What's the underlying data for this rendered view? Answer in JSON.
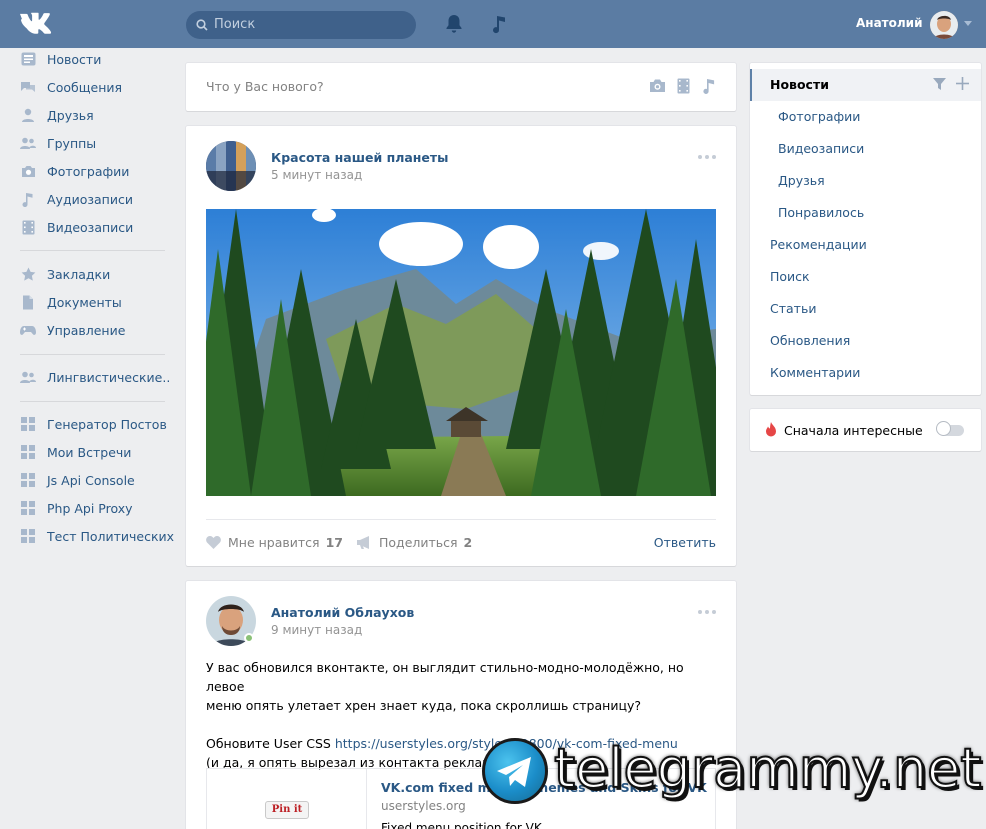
{
  "header": {
    "search_placeholder": "Поиск",
    "user_name": "Анатолий"
  },
  "leftnav": {
    "items": [
      {
        "label": "Новости",
        "icon": "news-icon"
      },
      {
        "label": "Сообщения",
        "icon": "messages-icon"
      },
      {
        "label": "Друзья",
        "icon": "friends-icon"
      },
      {
        "label": "Группы",
        "icon": "groups-icon"
      },
      {
        "label": "Фотографии",
        "icon": "camera-icon"
      },
      {
        "label": "Аудиозаписи",
        "icon": "music-icon"
      },
      {
        "label": "Видеозаписи",
        "icon": "film-icon"
      },
      {
        "label": "Закладки",
        "icon": "star-icon"
      },
      {
        "label": "Документы",
        "icon": "document-icon"
      },
      {
        "label": "Управление",
        "icon": "gamepad-icon"
      },
      {
        "label": "Лингвистические..",
        "icon": "community-icon"
      },
      {
        "label": "Генератор Постов",
        "icon": "app-icon"
      },
      {
        "label": "Мои Встречи",
        "icon": "app-icon"
      },
      {
        "label": "Js Api Console",
        "icon": "app-icon"
      },
      {
        "label": "Php Api Proxy",
        "icon": "app-icon"
      },
      {
        "label": "Тест Политических",
        "icon": "app-icon"
      }
    ]
  },
  "composer": {
    "placeholder": "Что у Вас нового?"
  },
  "post1": {
    "author": "Красота нашей планеты",
    "time": "5 минут назад",
    "like_label": "Мне нравится",
    "like_count": "17",
    "share_label": "Поделиться",
    "share_count": "2",
    "reply_label": "Ответить"
  },
  "post2": {
    "author": "Анатолий Облаухов",
    "time": "9 минут назад",
    "text_line1": "У вас обновился вконтакте, он выглядит стильно-модно-молодёжно, но левое",
    "text_line2": "меню опять улетает хрен знает куда, пока скроллишь страницу?",
    "text_line3_prefix": "Обновите User CSS ",
    "text_link": "https://userstyles.org/styles/92800/vk-com-fixed-menu",
    "text_line4": "(и да, я опять вырезал из контакта рекламу, на...й)",
    "attach_pin": "Pin it",
    "attach_title": "VK.com fixed menu - Themes and Skins for VK",
    "attach_site": "userstyles.org",
    "attach_desc": "Fixed menu position for VK"
  },
  "rightmenu": {
    "items": [
      {
        "label": "Новости",
        "level": "main",
        "active": true
      },
      {
        "label": "Фотографии",
        "level": "sub"
      },
      {
        "label": "Видеозаписи",
        "level": "sub"
      },
      {
        "label": "Друзья",
        "level": "sub"
      },
      {
        "label": "Понравилось",
        "level": "sub"
      },
      {
        "label": "Рекомендации",
        "level": "main"
      },
      {
        "label": "Поиск",
        "level": "main"
      },
      {
        "label": "Статьи",
        "level": "main"
      },
      {
        "label": "Обновления",
        "level": "main"
      },
      {
        "label": "Комментарии",
        "level": "main"
      }
    ]
  },
  "toggle": {
    "label": "Сначала интересные",
    "enabled": false
  },
  "watermark": {
    "text": "telegrammy.net"
  },
  "colors": {
    "header": "#5b7ca3",
    "link": "#2a5885",
    "background": "#edeef0"
  }
}
